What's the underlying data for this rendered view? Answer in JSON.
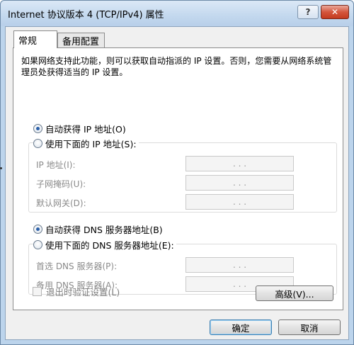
{
  "window": {
    "title": "Internet 协议版本 4 (TCP/IPv4) 属性",
    "help_label": "?",
    "close_label": "✕"
  },
  "tabs": [
    {
      "label": "常规",
      "selected": true
    },
    {
      "label": "备用配置",
      "selected": false
    }
  ],
  "description": "如果网络支持此功能，则可以获取自动指派的 IP 设置。否则，您需要从网络系统管理员处获得适当的 IP 设置。",
  "ip_section": {
    "auto_label": "自动获得 IP 地址(O)",
    "auto_checked": true,
    "manual_label": "使用下面的 IP 地址(S):",
    "manual_checked": false,
    "fields": [
      {
        "label": "IP 地址(I):",
        "value": ". . ."
      },
      {
        "label": "子网掩码(U):",
        "value": ". . ."
      },
      {
        "label": "默认网关(D):",
        "value": ". . ."
      }
    ]
  },
  "dns_section": {
    "auto_label": "自动获得 DNS 服务器地址(B)",
    "auto_checked": true,
    "manual_label": "使用下面的 DNS 服务器地址(E):",
    "manual_checked": false,
    "fields": [
      {
        "label": "首选 DNS 服务器(P):",
        "value": ". . ."
      },
      {
        "label": "备用 DNS 服务器(A):",
        "value": ". . ."
      }
    ]
  },
  "validate_label": "退出时验证设置(L)",
  "advanced_label": "高级(V)...",
  "ok_label": "确定",
  "cancel_label": "取消"
}
